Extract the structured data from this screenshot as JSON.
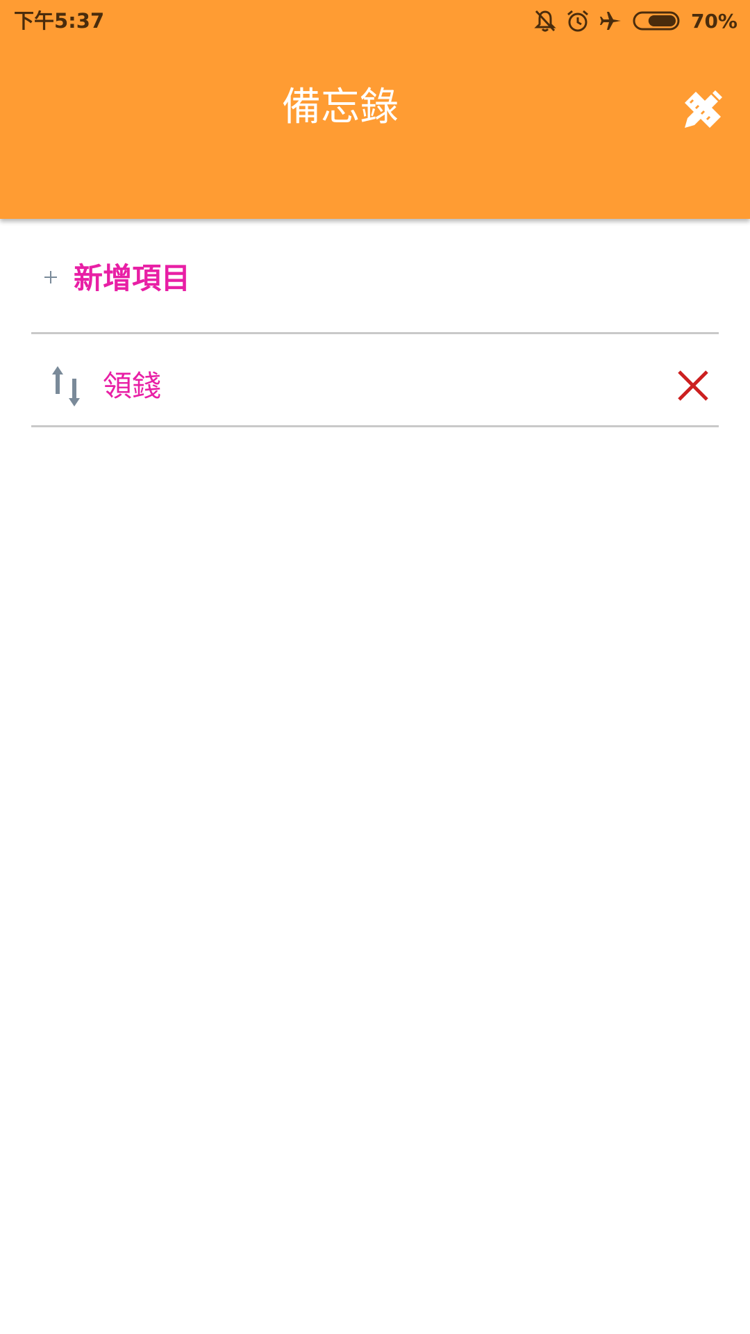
{
  "status_bar": {
    "time": "下午5:37",
    "battery_percent": "70%",
    "icons": [
      "bell-off-icon",
      "alarm-clock-icon",
      "airplane-icon",
      "battery-icon"
    ],
    "battery_level": 0.7
  },
  "app_bar": {
    "title": "備忘錄",
    "edit_icon": "pencil-ruler-icon",
    "background": "#ff9c33"
  },
  "add_item": {
    "icon": "plus-icon",
    "label": "新增項目"
  },
  "items": [
    {
      "label": "領錢",
      "handle_icon": "sort-arrows-icon",
      "delete_icon": "close-icon"
    }
  ],
  "colors": {
    "accent_text": "#e81fa5",
    "delete": "#cc1f1f",
    "divider": "#c9c9c9",
    "icon_gray": "#7a8a99"
  }
}
